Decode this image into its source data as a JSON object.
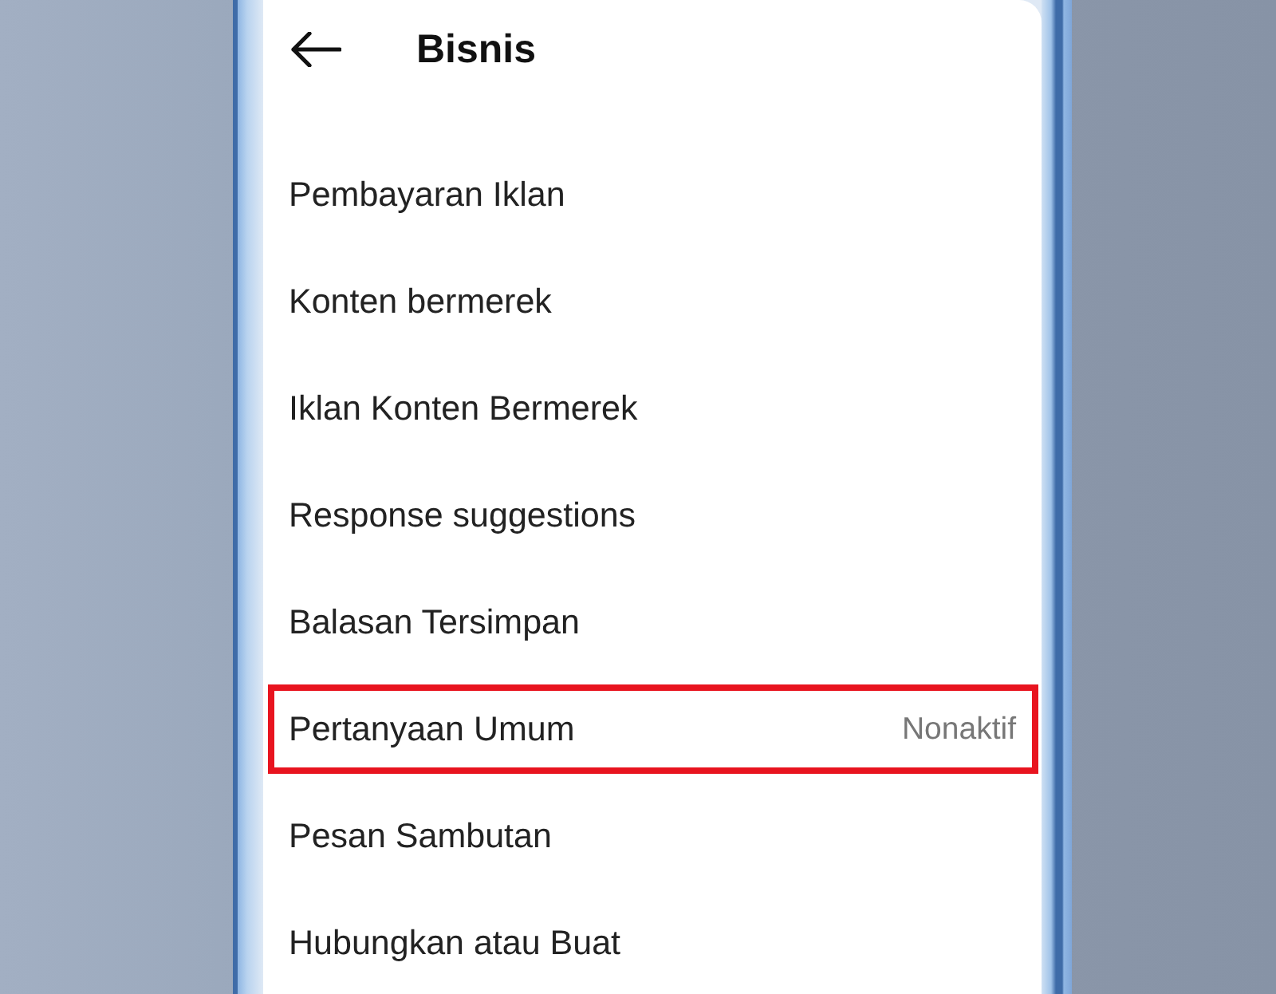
{
  "header": {
    "title": "Bisnis"
  },
  "menu": {
    "items": [
      {
        "label": "Pembayaran Iklan",
        "highlighted": false
      },
      {
        "label": "Konten bermerek",
        "highlighted": false
      },
      {
        "label": "Iklan Konten Bermerek",
        "highlighted": false
      },
      {
        "label": "Response suggestions",
        "highlighted": false
      },
      {
        "label": "Balasan Tersimpan",
        "highlighted": false
      },
      {
        "label": "Pertanyaan Umum",
        "status": "Nonaktif",
        "highlighted": true
      },
      {
        "label": "Pesan Sambutan",
        "highlighted": false
      },
      {
        "label": "Hubungkan atau Buat",
        "highlighted": false
      }
    ]
  }
}
